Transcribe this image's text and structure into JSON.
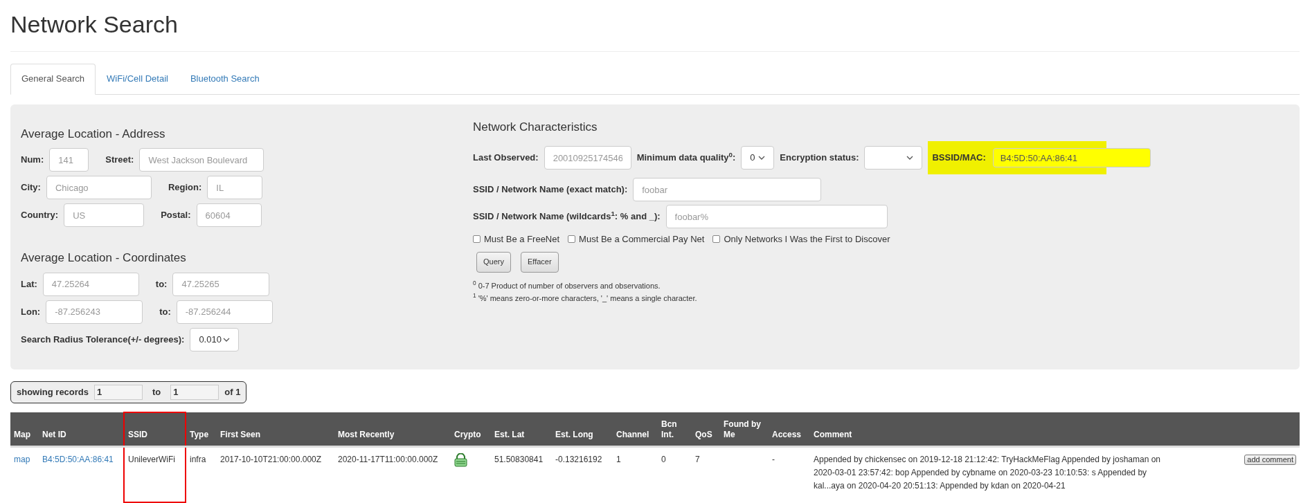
{
  "title": "Network Search",
  "tabs": [
    {
      "label": "General Search",
      "selected": true
    },
    {
      "label": "WiFi/Cell Detail",
      "selected": false
    },
    {
      "label": "Bluetooth Search",
      "selected": false
    }
  ],
  "address": {
    "heading": "Average Location - Address",
    "rows": [
      [
        {
          "label": "Num:",
          "placeholder": "141"
        },
        {
          "label": "Street:",
          "placeholder": "West Jackson Boulevard"
        }
      ],
      [
        {
          "label": "City:",
          "placeholder": "Chicago"
        },
        {
          "label": "Region:",
          "placeholder": "IL"
        }
      ],
      [
        {
          "label": "Country:",
          "placeholder": "US"
        },
        {
          "label": "Postal:",
          "placeholder": "60604"
        }
      ]
    ]
  },
  "coordinates": {
    "heading": "Average Location - Coordinates",
    "rows": [
      [
        {
          "label": "Lat:",
          "placeholder": "47.25264"
        },
        {
          "label": "to:",
          "placeholder": "47.25265"
        }
      ],
      [
        {
          "label": "Lon:",
          "placeholder": "-87.256243"
        },
        {
          "label": "to:",
          "placeholder": "-87.256244"
        }
      ]
    ],
    "radius": {
      "label": "Search Radius Tolerance(+/- degrees):",
      "value": "0.010"
    }
  },
  "network": {
    "heading": "Network Characteristics",
    "last_observed": {
      "label": "Last Observed:",
      "placeholder": "20010925174546"
    },
    "quality": {
      "label": "Minimum data quality$^{0}$:",
      "value": "0"
    },
    "encryption": {
      "label": "Encryption status:"
    },
    "bssid": {
      "label": "BSSID/MAC:",
      "value": "B4:5D:50:AA:86:41",
      "highlighted": true
    },
    "ssid_exact": {
      "label": "SSID / Network Name (exact match):",
      "placeholder": "foobar"
    },
    "ssid_wild": {
      "label": "SSID / Network Name (wildcards$^{1}$: % and _):",
      "placeholder": "foobar%"
    },
    "checkboxes": [
      {
        "label": "Must Be a FreeNet",
        "checked": false
      },
      {
        "label": "Must Be a Commercial Pay Net",
        "checked": false
      },
      {
        "label": "Only Networks I Was the First to Discover",
        "checked": false
      }
    ],
    "buttons": [
      "Query",
      "Effacer"
    ],
    "footnotes": [
      "$^{0}$ 0-7 Product of number of observers and observations.",
      "$^{1}$ '%' means zero-or-more characters, '_' means a single character."
    ]
  },
  "records": {
    "label": "showing records",
    "from": "1",
    "to_label": "to",
    "to": "1",
    "of": "of 1"
  },
  "table": {
    "columns": [
      {
        "label": "Map",
        "boxed": false
      },
      {
        "label": "Net ID",
        "boxed": false
      },
      {
        "label": "SSID",
        "boxed": true
      },
      {
        "label": "Type",
        "boxed": false
      },
      {
        "label": "First Seen",
        "boxed": false
      },
      {
        "label": "Most Recently",
        "boxed": false
      },
      {
        "label": "Crypto",
        "boxed": false
      },
      {
        "label": "Est. Lat",
        "boxed": false
      },
      {
        "label": "Est. Long",
        "boxed": false
      },
      {
        "label": "Channel",
        "boxed": false
      },
      {
        "label": "Bcn Int.",
        "boxed": false
      },
      {
        "label": "QoS",
        "boxed": false
      },
      {
        "label": "Found by Me",
        "boxed": false
      },
      {
        "label": "Access",
        "boxed": false
      },
      {
        "label": "Comment",
        "boxed": false
      }
    ],
    "rows": [
      [
        {
          "kind": "link",
          "text": "map"
        },
        {
          "kind": "link",
          "text": "B4:5D:50:AA:86:41"
        },
        {
          "kind": "text",
          "text": "UnileverWiFi"
        },
        {
          "kind": "text",
          "text": "infra"
        },
        {
          "kind": "text",
          "text": "2017-10-10T21:00:00.000Z"
        },
        {
          "kind": "text",
          "text": "2020-11-17T11:00:00.000Z"
        },
        {
          "kind": "crypto"
        },
        {
          "kind": "text",
          "text": "51.50830841"
        },
        {
          "kind": "text",
          "text": "-0.13216192"
        },
        {
          "kind": "text",
          "text": "1"
        },
        {
          "kind": "text",
          "text": "0"
        },
        {
          "kind": "text",
          "text": "7"
        },
        {
          "kind": "empty"
        },
        {
          "kind": "text",
          "text": "-"
        },
        {
          "kind": "text",
          "text": "Appended by chickensec on 2019-12-18 21:12:42: TryHackMeFlag Appended by joshaman on 2020-03-01 23:57:42: bop Appended by cybname on 2020-03-23 10:10:53: s Appended by kal...aya on 2020-04-20 20:51:13: Appended by kdan on 2020-04-21"
        },
        {
          "kind": "button",
          "text": "add comment"
        }
      ]
    ]
  }
}
